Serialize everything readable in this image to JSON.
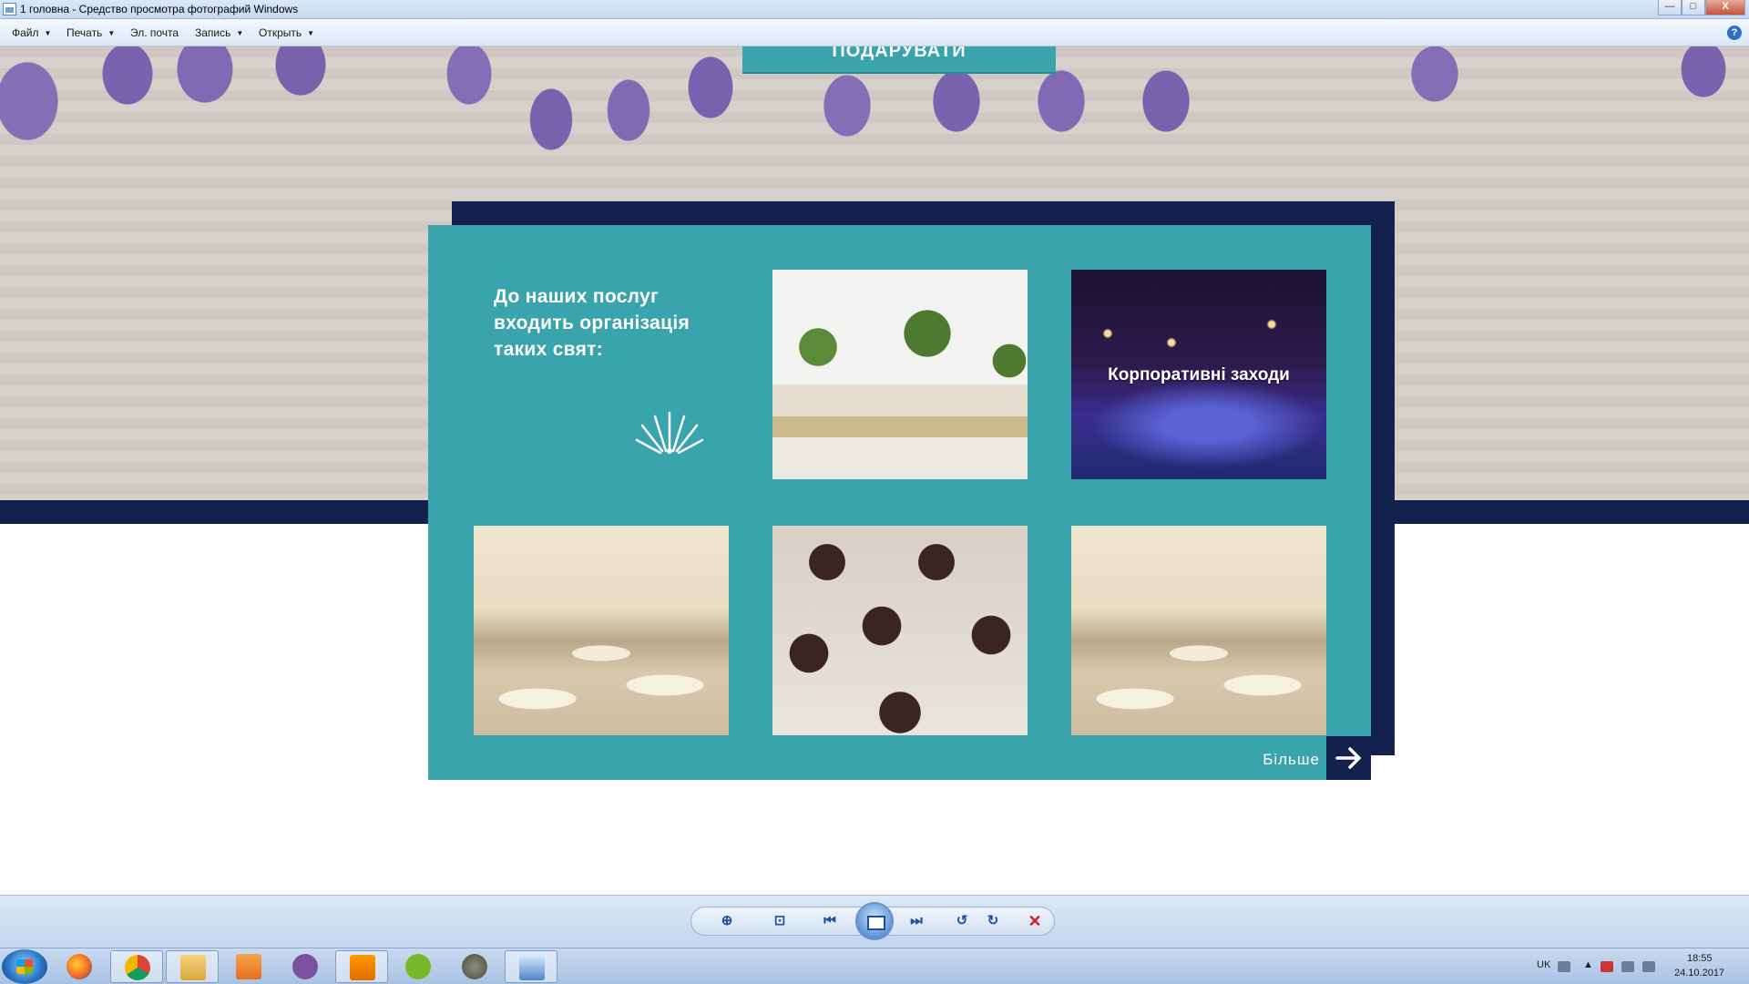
{
  "window": {
    "title": "1 головна - Средство просмотра фотографий Windows",
    "buttons": {
      "minimize": "—",
      "maximize": "□",
      "close": "X"
    }
  },
  "menubar": {
    "items": [
      "Файл",
      "Печать",
      "Эл. почта",
      "Запись",
      "Открыть"
    ],
    "help": "?"
  },
  "page": {
    "hero_button_label": "ПОДАРУВАТИ",
    "services_heading": "До наших послуг входить організація таких свят:",
    "tiles": [
      {
        "label": ""
      },
      {
        "label": "Корпоративні заходи"
      },
      {
        "label": ""
      },
      {
        "label": ""
      },
      {
        "label": ""
      }
    ],
    "more_label": "Більше",
    "colors": {
      "teal": "#3aa4ac",
      "navy": "#13214f"
    }
  },
  "toolbar": {
    "buttons": [
      "zoom-icon",
      "fit-icon",
      "previous-icon",
      "slideshow-icon",
      "next-icon",
      "rotate-left-icon",
      "rotate-right-icon",
      "delete-icon"
    ]
  },
  "taskbar": {
    "apps": [
      "firefox-icon",
      "chrome-icon",
      "explorer-icon",
      "media-player-icon",
      "viber-icon",
      "sublime-icon",
      "utorrent-icon",
      "gimp-icon",
      "photo-viewer-icon"
    ],
    "language": "UK",
    "time": "18:55",
    "date": "24.10.2017"
  }
}
